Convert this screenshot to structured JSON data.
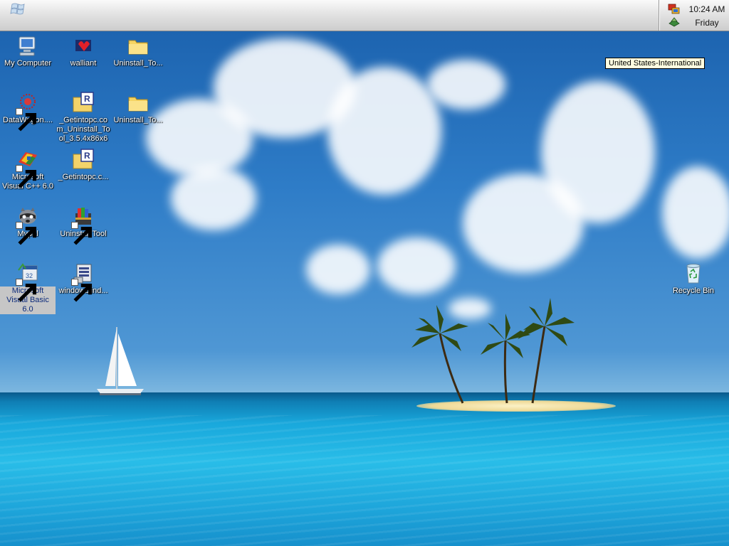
{
  "taskbar": {
    "start_icon": "windows-logo-icon",
    "tray": {
      "icons": [
        "network-icon",
        "language-icon"
      ],
      "time": "10:24 AM",
      "day": "Friday"
    }
  },
  "tooltip": {
    "text": "United States-International"
  },
  "desktop": {
    "wallpaper": "tropical-island-sailboat",
    "icons": [
      {
        "label": "My Computer",
        "icon": "computer-icon"
      },
      {
        "label": "walliant",
        "icon": "walliant-icon"
      },
      {
        "label": "Uninstall_To...",
        "icon": "folder-icon"
      },
      {
        "label": "DataWagon....",
        "icon": "datawagon-icon"
      },
      {
        "label": "_Getintopc.com_Uninstall_Tool_3.5.4x86x6",
        "icon": "archive-icon"
      },
      {
        "label": "Uninstall_To...",
        "icon": "folder-icon"
      },
      {
        "label": "Microsoft Visual C++ 6.0",
        "icon": "visual-cpp-icon"
      },
      {
        "label": "_Getintopc.c...",
        "icon": "archive-icon"
      },
      {
        "label": "Mypal",
        "icon": "mypal-icon"
      },
      {
        "label": "Uninstall Tool",
        "icon": "uninstall-tool-icon"
      },
      {
        "label": "Microsoft Visual Basic 6.0",
        "icon": "visual-basic-icon"
      },
      {
        "label": "windowblind...",
        "icon": "windowblinds-icon"
      },
      {
        "label": "Recycle Bin",
        "icon": "recycle-bin-icon"
      }
    ]
  },
  "colors": {
    "selection": "#c6c6c6",
    "selection_text": "#0c2a7a",
    "tooltip_bg": "#ffffe1"
  }
}
